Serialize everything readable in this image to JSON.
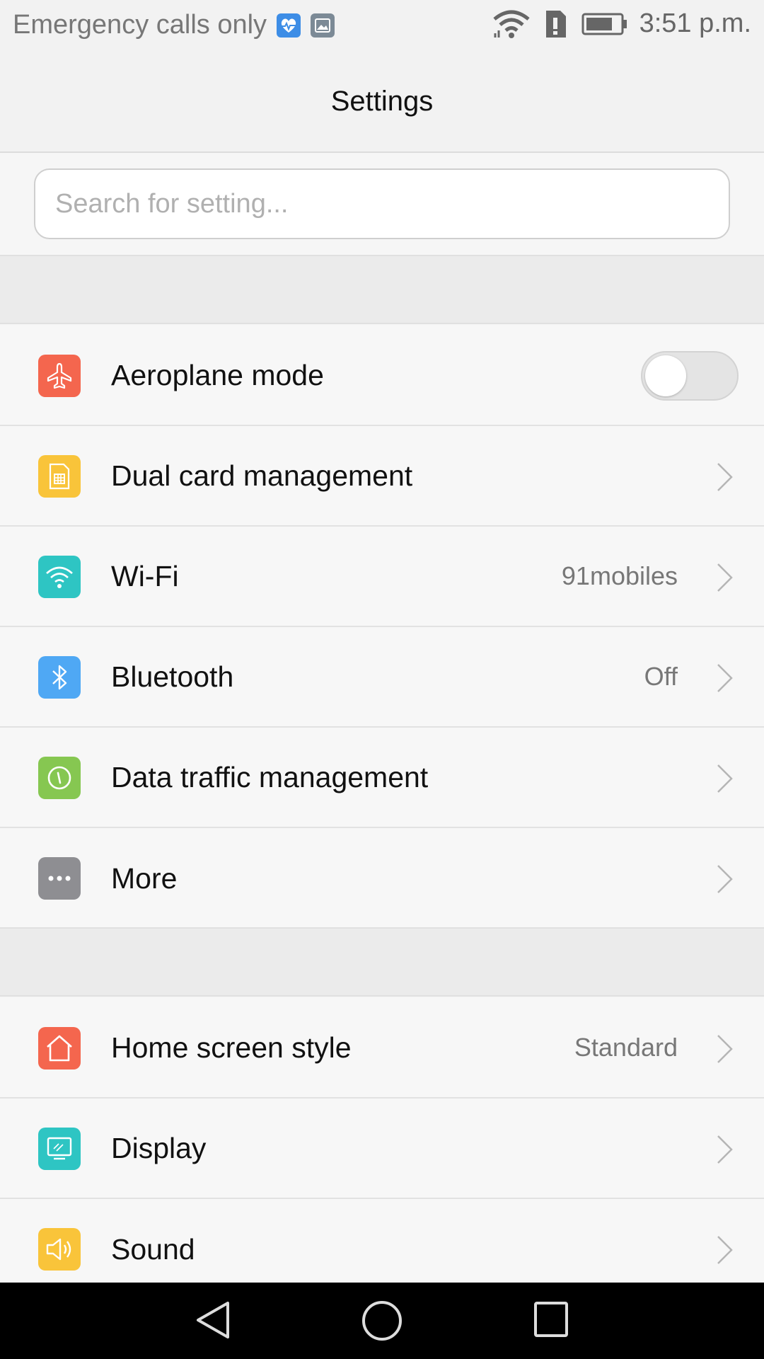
{
  "status_bar": {
    "carrier_text": "Emergency calls only",
    "time": "3:51 p.m.",
    "icons": [
      "health-notification-icon",
      "gallery-notification-icon",
      "wifi-icon",
      "sim-alert-icon",
      "battery-icon"
    ]
  },
  "header": {
    "title": "Settings"
  },
  "search": {
    "placeholder": "Search for setting..."
  },
  "group1": {
    "items": [
      {
        "label": "Aeroplane mode",
        "icon": "airplane-icon",
        "color": "#f4664e",
        "toggle_on": false
      },
      {
        "label": "Dual card management",
        "icon": "sim-card-icon",
        "color": "#f9c43a"
      },
      {
        "label": "Wi-Fi",
        "icon": "wifi-icon",
        "color": "#2ec5c3",
        "value": "91mobiles"
      },
      {
        "label": "Bluetooth",
        "icon": "bluetooth-icon",
        "color": "#4fa8f4",
        "value": "Off"
      },
      {
        "label": "Data traffic management",
        "icon": "data-usage-icon",
        "color": "#86c751"
      },
      {
        "label": "More",
        "icon": "more-icon",
        "color": "#8e8e92"
      }
    ]
  },
  "group2": {
    "items": [
      {
        "label": "Home screen style",
        "icon": "home-icon",
        "color": "#f4664e",
        "value": "Standard"
      },
      {
        "label": "Display",
        "icon": "display-icon",
        "color": "#2ec5c3"
      },
      {
        "label": "Sound",
        "icon": "sound-icon",
        "color": "#f9c43a"
      }
    ]
  },
  "nav_bar": {
    "buttons": [
      "back-icon",
      "home-icon",
      "recents-icon"
    ]
  }
}
